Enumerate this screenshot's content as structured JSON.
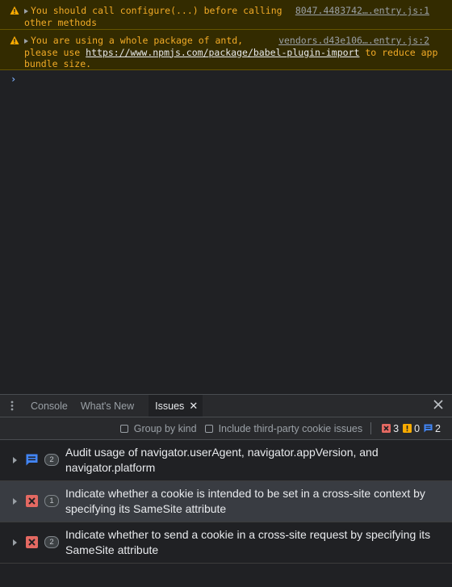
{
  "console": {
    "messages": [
      {
        "level": "warning",
        "text": "You should call configure(...) before calling other methods",
        "source": "8047.4483742….entry.js:1"
      },
      {
        "level": "warning",
        "text_before": "You are using a whole package of antd, please use ",
        "link": "https://www.npmjs.com/package/babel-plugin-import",
        "text_after": " to reduce app bundle size.",
        "source": "vendors.d43e106….entry.js:2"
      }
    ],
    "prompt_symbol": "›"
  },
  "drawer": {
    "tabs": [
      {
        "label": "Console",
        "active": false
      },
      {
        "label": "What's New",
        "active": false
      },
      {
        "label": "Issues",
        "active": true
      }
    ],
    "tab_close_symbol": "✕",
    "toolbar": {
      "group_by_kind": "Group by kind",
      "include_third_party": "Include third-party cookie issues",
      "counts": {
        "error": "3",
        "warning": "0",
        "info": "2"
      }
    },
    "issues": [
      {
        "kind": "info",
        "count": "2",
        "text": "Audit usage of navigator.userAgent, navigator.appVersion, and navigator.platform"
      },
      {
        "kind": "error",
        "count": "1",
        "text": "Indicate whether a cookie is intended to be set in a cross-site context by specifying its SameSite attribute"
      },
      {
        "kind": "error",
        "count": "2",
        "text": "Indicate whether to send a cookie in a cross-site request by specifying its SameSite attribute"
      }
    ]
  },
  "colors": {
    "warning_text": "#f2ab26",
    "warning_bg": "#332b00",
    "error": "#e46962",
    "info": "#4285f4",
    "warn_badge": "#f9ab00"
  }
}
